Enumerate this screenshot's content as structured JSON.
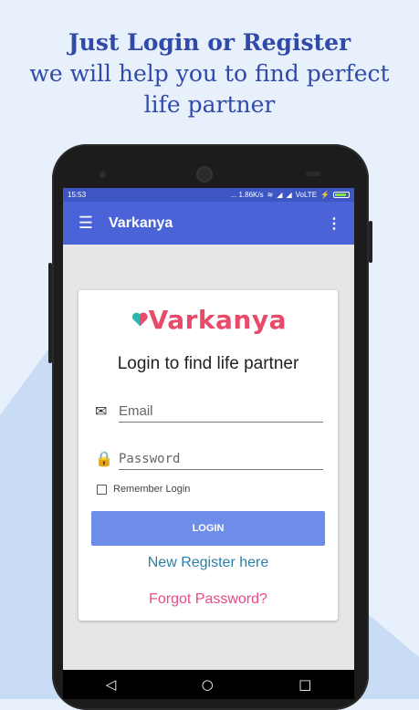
{
  "headline": {
    "line1": "Just Login or Register",
    "line2": "we will help you to find perfect",
    "line3": "life partner"
  },
  "status_bar": {
    "time": "15:53",
    "speed": "... 1.86K/s",
    "network": "VoLTE"
  },
  "app_bar": {
    "title": "Varkanya",
    "menu_icon": "hamburger-menu-icon",
    "overflow_icon": "more-vert-icon"
  },
  "login_card": {
    "logo_text": "Varkanya",
    "heading": "Login to find life partner",
    "email_placeholder": "Email",
    "password_placeholder": "Password",
    "remember_label": "Remember Login",
    "login_button": "LOGIN",
    "register_link": "New Register here",
    "forgot_link": "Forgot Password?"
  },
  "colors": {
    "background": "#e8f0fb",
    "headline": "#2f4aa8",
    "app_bar": "#4a63d6",
    "status_bar": "#3d56c4",
    "button": "#6d8de8",
    "register_link": "#2a7fa6",
    "forgot_link": "#e84a8a",
    "logo": "#e84a6a"
  }
}
